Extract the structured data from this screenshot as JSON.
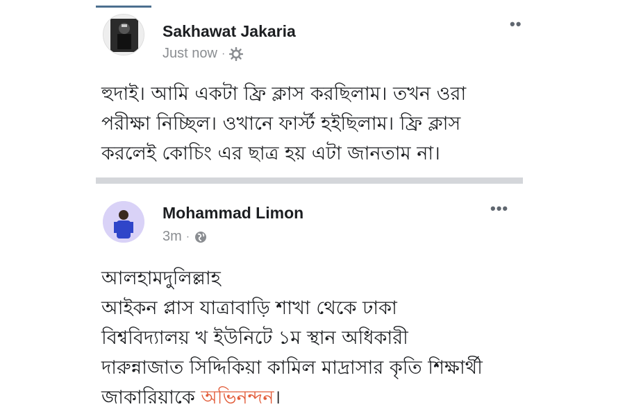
{
  "colors": {
    "accent_bar": "#4b6f8f",
    "separator": "#d4d6da",
    "meta_text": "#8a8d91",
    "highlight": "#e25d3a",
    "avatar_2_bg": "#d9d2f7"
  },
  "posts": [
    {
      "author": "Sakhawat Jakaria",
      "time": "Just now",
      "separator_dot": "·",
      "privacy_icon": "gear-icon",
      "more_label": "••",
      "lines": [
        "হুদাই। আমি একটা ফ্রি ক্লাস করছিলাম। তখন ওরা",
        "পরীক্ষা নিচ্ছিল। ওখানে ফার্স্ট হইছিলাম। ফ্রি ক্লাস",
        "করলেই কোচিং এর ছাত্র হয় এটা জানতাম না।"
      ]
    },
    {
      "author": "Mohammad Limon",
      "time": "3m",
      "separator_dot": "·",
      "privacy_icon": "globe-icon",
      "more_label": "•••",
      "lines": [
        "আলহামদুলিল্লাহ",
        "আইকন প্লাস যাত্রাবাড়ি শাখা  থেকে ঢাকা",
        "বিশ্ববিদ্যালয় খ ইউনিটে ১ম স্থান অধিকারী",
        "দারুন্নাজাত সিদ্দিকিয়া কামিল মাদ্রাসার কৃতি শিক্ষার্থী"
      ],
      "last_line_prefix": "জাকারিয়াকে ",
      "last_line_highlight": "অভিনন্দন",
      "last_line_suffix": "।"
    }
  ]
}
